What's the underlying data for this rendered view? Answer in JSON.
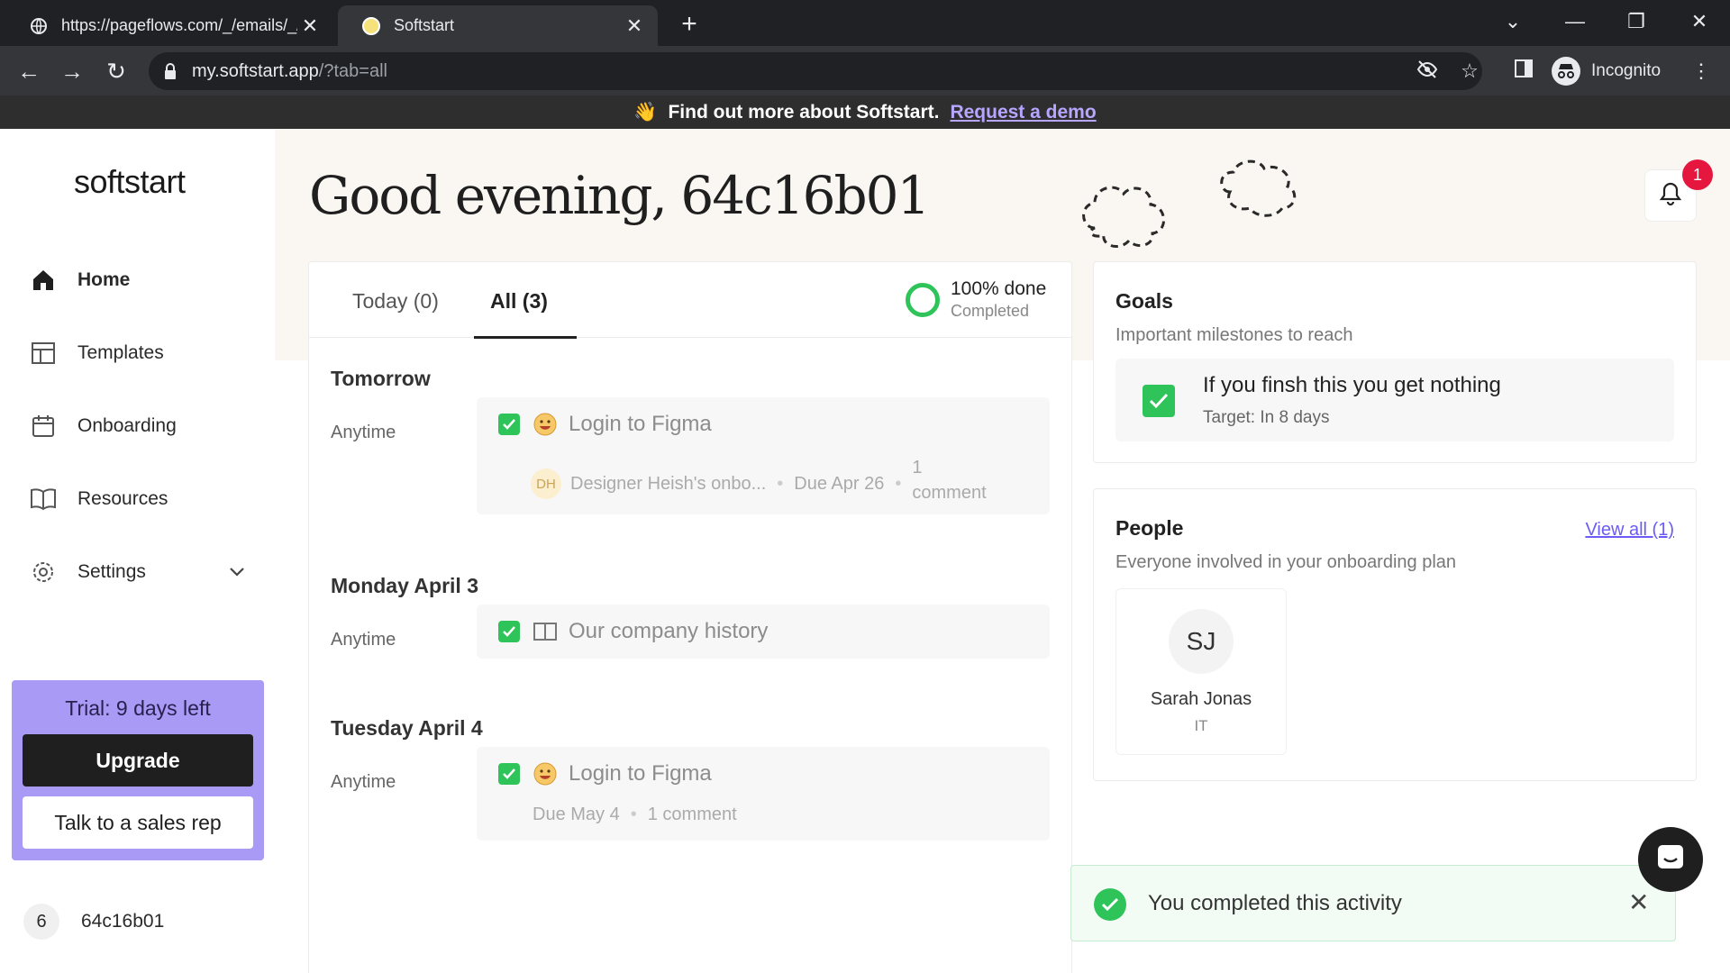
{
  "browser": {
    "tabs": [
      {
        "title": "https://pageflows.com/_/emails/_/",
        "icon": "globe-icon"
      },
      {
        "title": "Softstart",
        "icon": "softstart-favicon"
      }
    ],
    "url_host": "my.softstart.app",
    "url_path": "/?tab=all",
    "profile": "Incognito"
  },
  "banner": {
    "emoji": "👋",
    "text": "Find out more about Softstart.",
    "link": "Request a demo"
  },
  "sidebar": {
    "logo": "softstart",
    "items": [
      {
        "label": "Home",
        "icon": "home-icon"
      },
      {
        "label": "Templates",
        "icon": "layout-icon"
      },
      {
        "label": "Onboarding",
        "icon": "calendar-icon"
      },
      {
        "label": "Resources",
        "icon": "book-icon"
      },
      {
        "label": "Settings",
        "icon": "gear-icon"
      }
    ],
    "trial": {
      "label": "Trial: 9 days left",
      "upgrade": "Upgrade",
      "sales": "Talk to a sales rep"
    },
    "user": {
      "count": "6",
      "name": "64c16b01"
    }
  },
  "main": {
    "greeting": "Good evening, 64c16b01",
    "notifications": "1",
    "tabs": [
      {
        "label": "Today (0)"
      },
      {
        "label": "All (3)"
      }
    ],
    "progress": {
      "title": "100% done",
      "status": "Completed",
      "fraction": 1.0
    },
    "sections": [
      {
        "title": "Tomorrow",
        "time": "Anytime",
        "task": "Login to Figma",
        "owner_initials": "DH",
        "owner": "Designer Heish's onbo...",
        "due": "Due Apr 26",
        "comments_1": "1",
        "comments_2": "comment"
      },
      {
        "title": "Monday April 3",
        "time": "Anytime",
        "task": "Our company history"
      },
      {
        "title": "Tuesday April 4",
        "time": "Anytime",
        "task": "Login to Figma",
        "due": "Due May 4",
        "comments": "1 comment"
      }
    ]
  },
  "goals": {
    "title": "Goals",
    "subtitle": "Important milestones to reach",
    "item_title": "If you finsh this you get nothing",
    "item_target": "Target: In 8 days"
  },
  "people": {
    "title": "People",
    "view_all": "View all (1)",
    "subtitle": "Everyone involved in your onboarding plan",
    "person": {
      "initials": "SJ",
      "name": "Sarah Jonas",
      "role": "IT"
    }
  },
  "toast": {
    "text": "You completed this activity"
  },
  "colors": {
    "accent": "#a89af5",
    "success": "#2fc45a",
    "badge": "#e5173f",
    "link": "#6a5cf5"
  }
}
